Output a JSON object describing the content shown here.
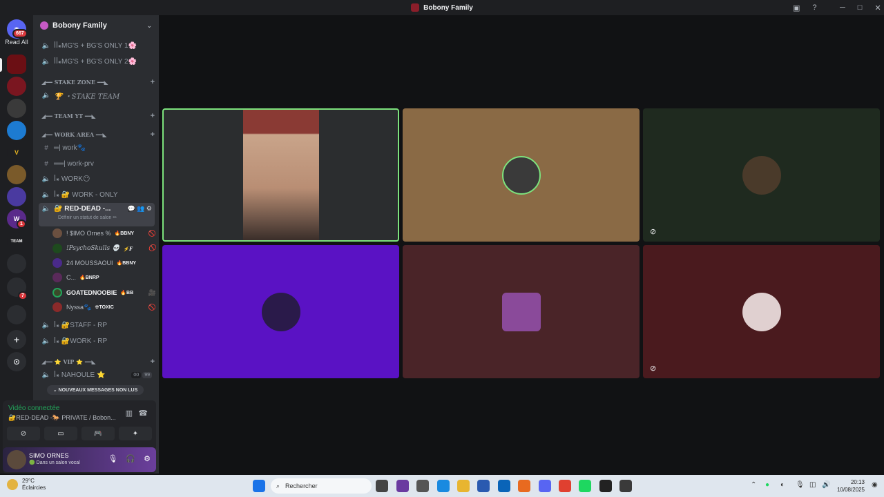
{
  "window": {
    "title": "Bobony Family"
  },
  "guilds": {
    "dm_badge": "667",
    "read_all": "Read All",
    "badges": [
      "1",
      "7"
    ]
  },
  "server": {
    "name": "Bobony Family",
    "channels": [
      {
        "name": "ꟾꟾ꘎MG'S + BG'S ONLY 1🌸"
      },
      {
        "name": "ꟾꟾ꘎MG'S + BG'S ONLY 2🌸"
      }
    ],
    "categories": {
      "stake_zone": "◢━━ STAKE ZONE ━━◣",
      "team_yt": "◢━━ TEAM YT ━━◣",
      "work_area": "◢━━ WORK AREA ━━◣",
      "vip": "◢━━ ⭐ VIP ⭐ ━━◣"
    },
    "stake_team": "🏆 ・STAKE TEAM",
    "work_channels": [
      {
        "name": "═| work🐾"
      },
      {
        "name": "══| work-prv"
      },
      {
        "name": "ꟾ꘎ WORK😶"
      },
      {
        "name": "ꟾ꘎ 🔐 WORK - ONLY"
      }
    ],
    "active_channel": {
      "name": "🔐 RED-DEAD -...",
      "status": "Définir un statut de salon ✏"
    },
    "voice_users": [
      {
        "name": "! $IMO Ornes %",
        "tag": "🔥BBNY"
      },
      {
        "name": "!PsychoSkulls 💀",
        "tag": "⚡F"
      },
      {
        "name": "24 MOUSSAOUI",
        "tag": "🔥BBNY"
      },
      {
        "name": "C...",
        "tag": "🔥BNRP"
      },
      {
        "name": "GOATEDNOOBIE",
        "tag": "🔥BB"
      },
      {
        "name": "Nyssa🐾",
        "tag": "☢TOXIC"
      }
    ],
    "rp_channels": [
      {
        "name": "ꟾ꘎ 🔐STAFF - RP"
      },
      {
        "name": "ꟾ꘎ 🔐WORK - RP"
      }
    ],
    "vip_channel": {
      "name": "ꟾ꘎ NAHOULE ⭐",
      "c1": "00",
      "c2": "99"
    },
    "new_messages": "NOUVEAUX MESSAGES NON LUS"
  },
  "voice_panel": {
    "status": "Vidéo connectée",
    "channel": "🔐RED-DEAD -🐎 PRIVATE / Bobon..."
  },
  "user_bar": {
    "name": "SIMO ORNES",
    "status": "🟢 Dans un salon vocal"
  },
  "taskbar": {
    "temperature": "29°C",
    "weather": "Éclaircies",
    "search_placeholder": "Rechercher",
    "time": "20:13",
    "date": "10/08/2025"
  },
  "colors": {
    "tile1": "#2b2d2f",
    "tile2": "#8a6a45",
    "tile3": "#1f2a1f",
    "tile4": "#5a12c4",
    "tile5": "#4a2428",
    "tile6": "#4a1a1e",
    "speaking": "#7de37d"
  }
}
